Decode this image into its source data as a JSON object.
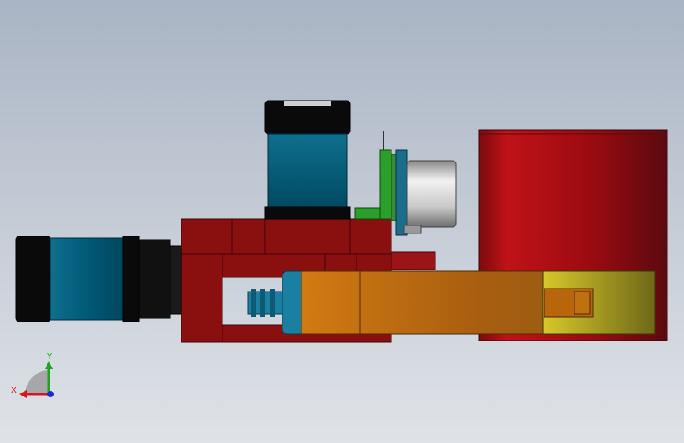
{
  "viewport": {
    "background_top": "#a9b4c4",
    "background_bottom": "#dfe3e8"
  },
  "triad": {
    "x_label": "X",
    "y_label": "Y",
    "x_color": "#d11a1a",
    "y_color": "#1fa31f",
    "z_color": "#1a2ad1"
  },
  "parts": {
    "stepper_top": "stepper-motor-vertical",
    "stepper_left": "stepper-motor-horizontal",
    "base_block": "base-bracket",
    "arm": "swing-arm",
    "gear": "spur-gear",
    "sensor": "ultrasonic-sensor",
    "cylinder": "red-cylinder",
    "link": "yellow-link"
  },
  "colors": {
    "stepper_body": "#005a78",
    "stepper_cap": "#0a0a0a",
    "bracket": "#8a1010",
    "arm": "#b8650c",
    "gear": "#1a7fa0",
    "pcb": "#2aa02a",
    "sensor_can": "#d0d0d0",
    "cylinder": "#a80c12",
    "link": "#b8aa1e"
  }
}
